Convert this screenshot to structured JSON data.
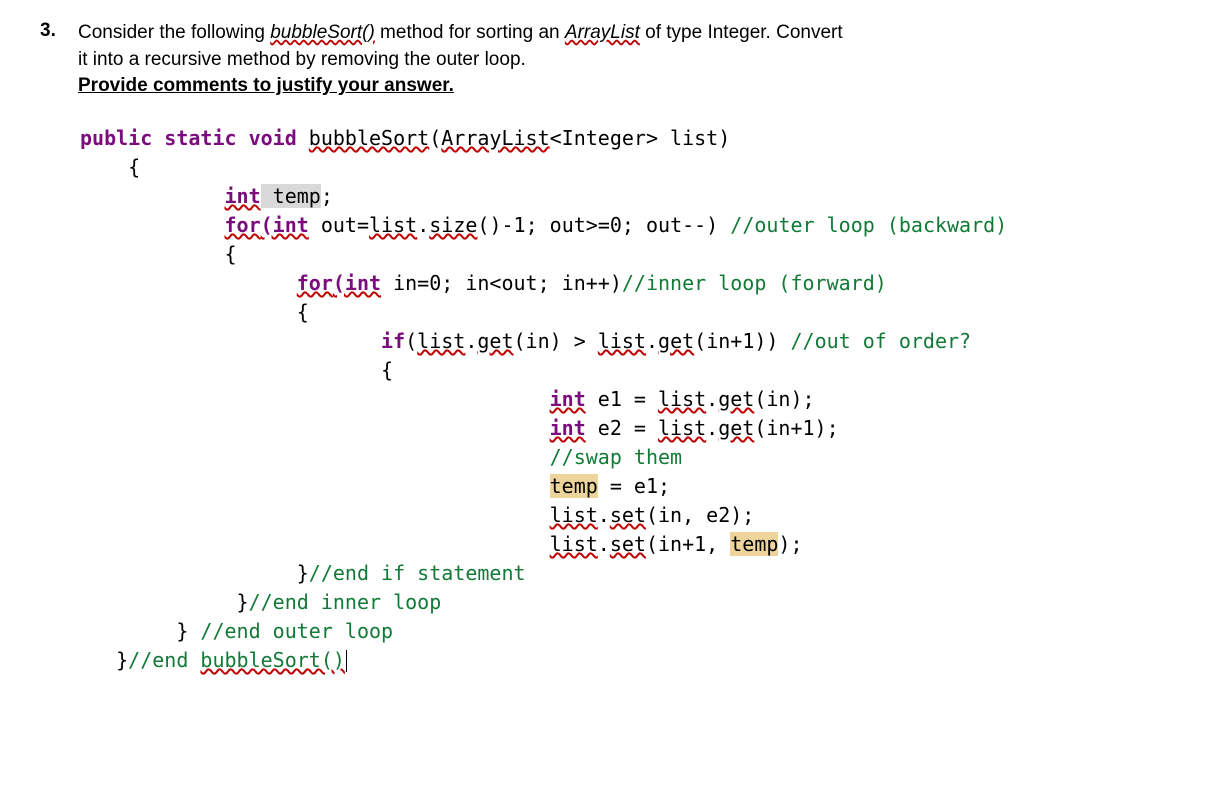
{
  "question": {
    "number": "3.",
    "line1_a": "Consider the following ",
    "line1_method": "bubbleSort()",
    "line1_b": " method for sorting an ",
    "line1_class": "ArrayList",
    "line1_c": " of type Integer. Convert",
    "line2": "it into a recursive method by removing the outer loop.",
    "line3": "Provide comments to justify your answer."
  },
  "code": {
    "sig_kw1": "public static void",
    "sig_name": "bubbleSort",
    "sig_paren_open": "(",
    "sig_type": "ArrayList",
    "sig_generic": "<Integer> list)",
    "obrace": "    {",
    "l_int": "int",
    "l_temp": " temp",
    "l_semi": ";",
    "outer_for": "for",
    "outer_par_int": "(int",
    "outer_assign": " out=",
    "outer_list": "list",
    "outer_dot1": ".",
    "outer_size": "size",
    "outer_rest": "()-1; out>=0; out--) ",
    "outer_cmt": "//outer loop (backward)",
    "outer_ob": "            {",
    "inner_indent": "                  ",
    "inner_for": "for",
    "inner_parint": "(int",
    "inner_rest": " in=0; in<out; in++)",
    "inner_cmt": "//inner loop (forward)",
    "inner_ob": "                  {",
    "if_indent": "                         ",
    "if_kw": "if",
    "if_par": "(",
    "if_list1": "list",
    "if_dot": ".",
    "if_get": "get",
    "if_arg1": "(in) > ",
    "if_list2": "list",
    "if_get2": "get",
    "if_arg2": "(in+1)) ",
    "if_cmt": "//out of order?",
    "if_ob": "                         {",
    "swap_indent": "                                       ",
    "s1_int": "int",
    "s1_txt": " e1 = ",
    "s1_list": "list",
    "s1_get": "get",
    "s1_arg": "(in);",
    "s2_int": "int",
    "s2_txt": " e2 = ",
    "s2_list": "list",
    "s2_get": "get",
    "s2_arg": "(in+1);",
    "s3_cmt": "//swap them",
    "s4_temp": "temp",
    "s4_rest": " = e1;",
    "s5_list": "list",
    "s5_set": "set",
    "s5_arg": "(in, e2);",
    "s6_list": "list",
    "s6_set": "set",
    "s6_arg_a": "(in+1, ",
    "s6_temp": "temp",
    "s6_arg_b": ");",
    "close_if": "                  }",
    "close_if_cmt": "//end if statement",
    "close_inner": "             }",
    "close_inner_cmt": "//end inner loop",
    "close_outer": "        } ",
    "close_outer_cmt": "//end outer loop",
    "close_fn": "   }",
    "close_fn_cmt_a": "//end ",
    "close_fn_cmt_b": "bubbleSort()"
  }
}
